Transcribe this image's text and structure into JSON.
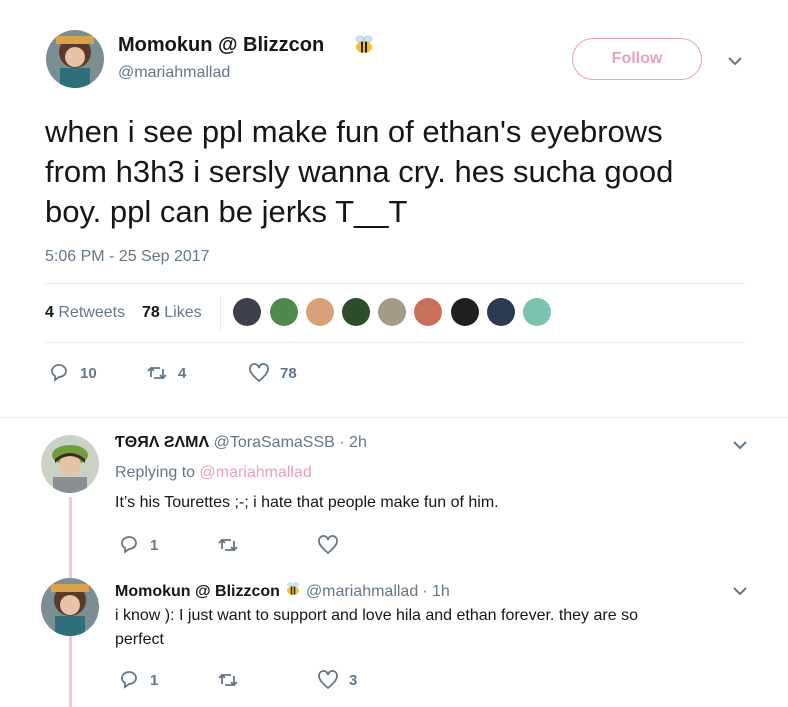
{
  "tweet": {
    "author_name": "Momokun @ Blizzcon",
    "author_handle": "@mariahmallad",
    "follow_label": "Follow",
    "text_line1": "when i see ppl make fun of ethan's eyebrows",
    "text_line2": "from h3h3 i sersly wanna cry. hes sucha good",
    "text_line3": "boy. ppl can be jerks T__T",
    "timestamp": "5:06 PM - 25 Sep 2017",
    "retweets_count": "4",
    "retweets_label": "Retweets",
    "likes_count": "78",
    "likes_label": "Likes",
    "actions": {
      "replies": "10",
      "retweets": "4",
      "likes": "78"
    }
  },
  "replies": [
    {
      "name": "ƬΘЯΛ ƧΛMΛ",
      "handle": "@ToraSamaSSB",
      "time": "· 2h",
      "replying_prefix": "Replying to",
      "replying_to": "@mariahmallad",
      "text": "It’s his Tourettes ;-; i hate that people make fun of him.",
      "actions": {
        "replies": "1",
        "retweets": "",
        "likes": ""
      }
    },
    {
      "name": "Momokun @ Blizzcon",
      "handle": "@mariahmallad",
      "time": "· 1h",
      "text_line1": "i know ): I just want to support and love hila and ethan forever. they are so",
      "text_line2": "perfect",
      "actions": {
        "replies": "1",
        "retweets": "",
        "likes": "3"
      }
    }
  ],
  "colors": {
    "follow": "#e8a3b6",
    "thread_line": "#f5c9d4",
    "link": "#e8a3b6",
    "muted": "#657786"
  },
  "icons": [
    "bee-icon",
    "chevron-down-icon",
    "reply-icon",
    "retweet-icon",
    "like-icon"
  ]
}
